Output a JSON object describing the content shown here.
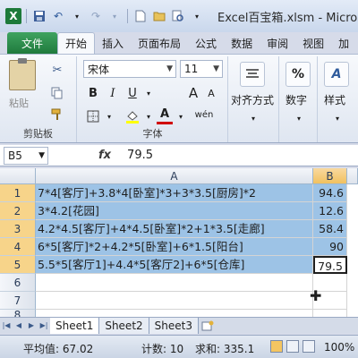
{
  "window": {
    "title": "Excel百宝箱.xlsm - Microsoft Ex",
    "app_icon": "X"
  },
  "ribbon_tabs": {
    "file": "文件",
    "items": [
      "开始",
      "插入",
      "页面布局",
      "公式",
      "数据",
      "审阅",
      "视图",
      "加"
    ]
  },
  "ribbon": {
    "clipboard": {
      "paste": "粘贴",
      "group": "剪贴板"
    },
    "font": {
      "name": "宋体",
      "size": "11",
      "bold": "B",
      "italic": "I",
      "underline": "U",
      "font_color": "A",
      "wen": "wén",
      "group": "字体"
    },
    "align": {
      "label": "对齐方式"
    },
    "number": {
      "label": "数字",
      "symbol": "%"
    },
    "styles": {
      "label": "样式",
      "symbol": "A"
    }
  },
  "formula_bar": {
    "name_box": "B5",
    "fx": "fx",
    "value": "79.5"
  },
  "grid": {
    "columns": [
      "A",
      "B"
    ],
    "rows": [
      {
        "num": "1",
        "a": "7*4[客厅]+3.8*4[卧室]*3+3*3.5[厨房]*2",
        "b": "94.6"
      },
      {
        "num": "2",
        "a": "3*4.2[花园]",
        "b": "12.6"
      },
      {
        "num": "3",
        "a": "4.2*4.5[客厅]+4*4.5[卧室]*2+1*3.5[走廊]",
        "b": "58.4"
      },
      {
        "num": "4",
        "a": "6*5[客厅]*2+4.2*5[卧室]+6*1.5[阳台]",
        "b": "90"
      },
      {
        "num": "5",
        "a": "5.5*5[客厅1]+4.4*5[客厅2]+6*5[仓库]",
        "b": "79.5"
      },
      {
        "num": "6",
        "a": "",
        "b": ""
      },
      {
        "num": "7",
        "a": "",
        "b": ""
      },
      {
        "num": "8",
        "a": "",
        "b": ""
      }
    ]
  },
  "sheets": {
    "tabs": [
      "Sheet1",
      "Sheet2",
      "Sheet3"
    ],
    "active": "Sheet1"
  },
  "status": {
    "average": "平均值: 67.02",
    "count": "计数: 10",
    "sum": "求和: 335.1",
    "zoom": "100%"
  }
}
